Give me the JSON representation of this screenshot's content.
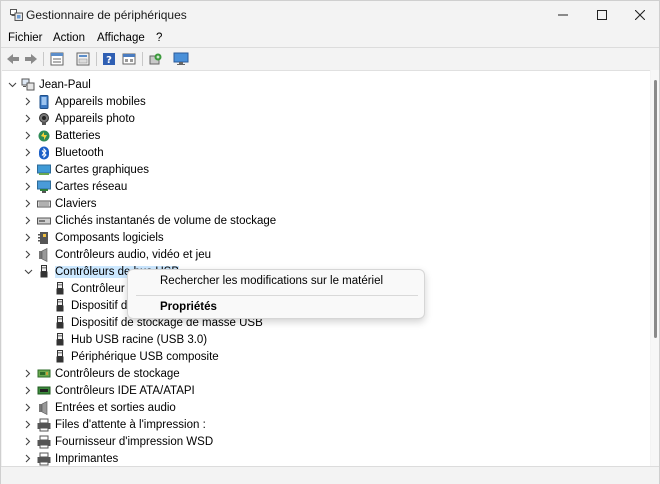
{
  "window": {
    "title": "Gestionnaire de périphériques",
    "controls": [
      "minimize",
      "maximize",
      "close"
    ]
  },
  "menu": {
    "items": [
      "Fichier",
      "Action",
      "Affichage",
      "?"
    ]
  },
  "toolbar": {
    "buttons": [
      "back-arrow-icon",
      "forward-arrow-icon",
      "view-icon",
      "properties-icon",
      "help-icon",
      "devices-icon",
      "scan-hardware-icon",
      "monitor-icon"
    ]
  },
  "tree": {
    "root": "Jean-Paul",
    "categories": [
      {
        "label": "Appareils mobiles",
        "icon": "mobile-device-icon"
      },
      {
        "label": "Appareils photo",
        "icon": "camera-icon"
      },
      {
        "label": "Batteries",
        "icon": "battery-icon"
      },
      {
        "label": "Bluetooth",
        "icon": "bluetooth-icon"
      },
      {
        "label": "Cartes graphiques",
        "icon": "display-adapter-icon"
      },
      {
        "label": "Cartes réseau",
        "icon": "network-adapter-icon"
      },
      {
        "label": "Claviers",
        "icon": "keyboard-icon"
      },
      {
        "label": "Clichés instantanés de volume de stockage",
        "icon": "storage-volume-icon"
      },
      {
        "label": "Composants logiciels",
        "icon": "software-component-icon"
      },
      {
        "label": "Contrôleurs audio, vidéo et jeu",
        "icon": "audio-icon"
      },
      {
        "label": "Contrôleurs de bus USB",
        "icon": "usb-icon",
        "expanded": true,
        "selected": true
      },
      {
        "label": "Contrôleurs de stockage",
        "icon": "storage-controller-icon"
      },
      {
        "label": "Contrôleurs IDE ATA/ATAPI",
        "icon": "ide-controller-icon"
      },
      {
        "label": "Entrées et sorties audio",
        "icon": "audio-io-icon"
      },
      {
        "label": "Files d'attente à l'impression :",
        "icon": "print-queue-icon"
      },
      {
        "label": "Fournisseur d'impression WSD",
        "icon": "printer-icon"
      },
      {
        "label": "Imprimantes",
        "icon": "printer-icon"
      }
    ],
    "usb_children": [
      {
        "label": "Contrôleur",
        "icon": "usb-icon"
      },
      {
        "label": "Dispositif d",
        "icon": "usb-icon"
      },
      {
        "label": "Dispositif de stockage de masse USB",
        "icon": "usb-icon"
      },
      {
        "label": "Hub USB racine (USB 3.0)",
        "icon": "usb-icon"
      },
      {
        "label": "Périphérique USB composite",
        "icon": "usb-icon"
      }
    ]
  },
  "context_menu": {
    "items": [
      {
        "label": "Rechercher les modifications sur le matériel",
        "bold": false
      },
      {
        "label": "Propriétés",
        "bold": true
      }
    ]
  },
  "colors": {
    "selection": "#cce8ff",
    "window_bg": "#f3f3f3",
    "content_bg": "#ffffff"
  }
}
